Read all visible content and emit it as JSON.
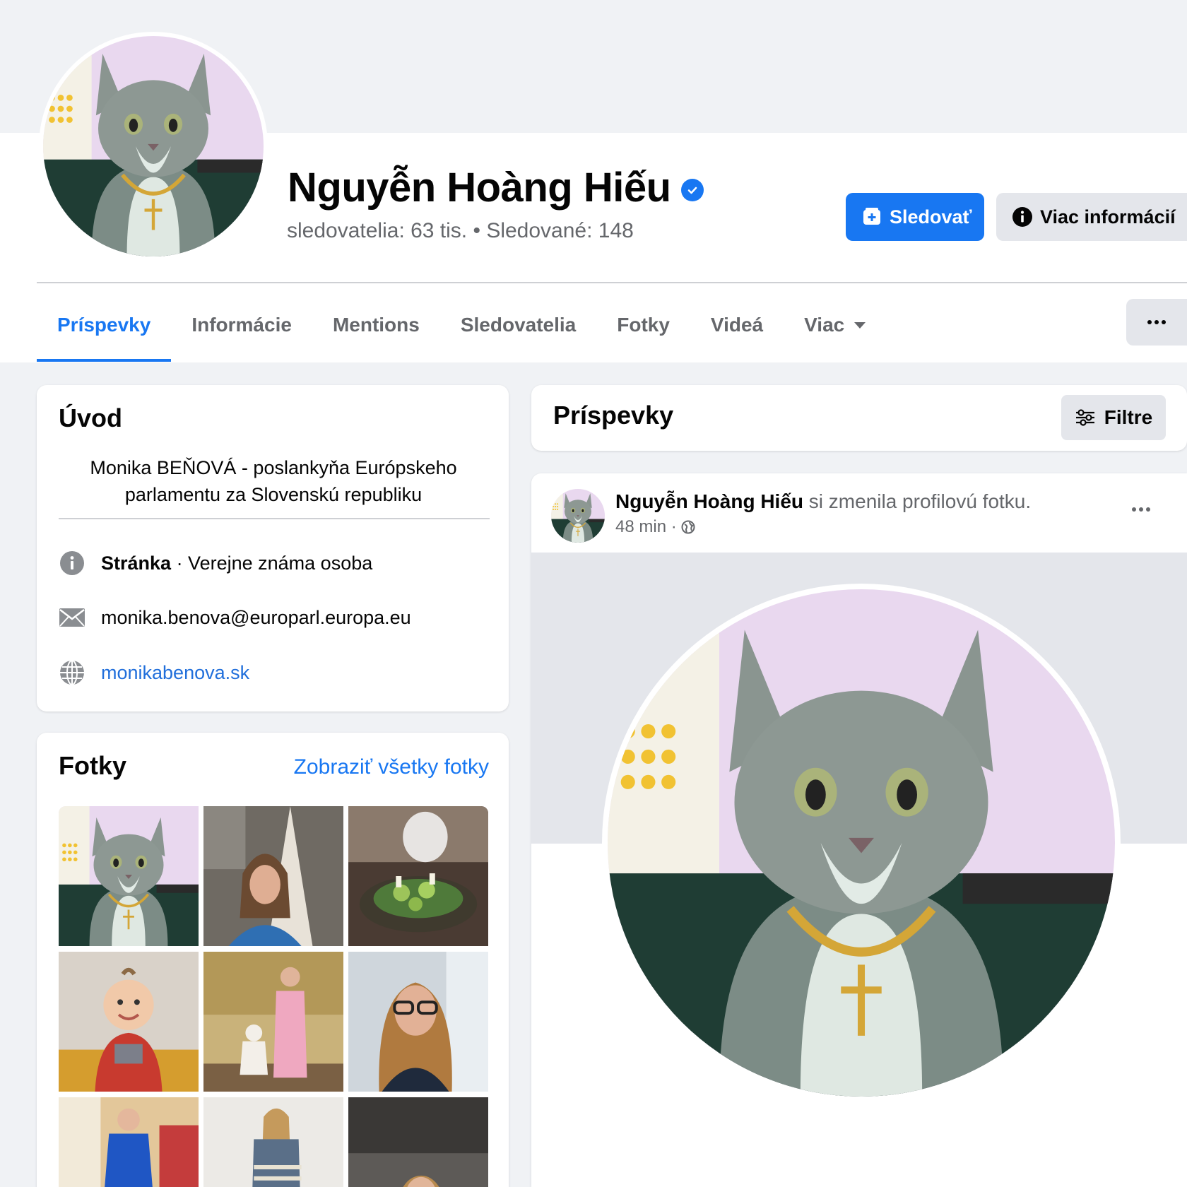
{
  "profile": {
    "name": "Nguyễn Hoàng Hiếu",
    "stats": "sledovatelia: 63 tis. • Sledované: 148",
    "follow_label": "Sledovať",
    "more_info_label": "Viac informácií"
  },
  "tabs": [
    {
      "label": "Príspevky",
      "active": true
    },
    {
      "label": "Informácie"
    },
    {
      "label": "Mentions"
    },
    {
      "label": "Sledovatelia"
    },
    {
      "label": "Fotky"
    },
    {
      "label": "Videá"
    },
    {
      "label": "Viac"
    }
  ],
  "intro": {
    "title": "Úvod",
    "bio": "Monika BEŇOVÁ - poslankyňa Európskeho parlamentu za Slovenskú republiku",
    "category_label": "Stránka",
    "category_value": " · Verejne známa osoba",
    "email": "monika.benova@europarl.europa.eu",
    "website": "monikabenova.sk"
  },
  "photos": {
    "title": "Fotky",
    "see_all": "Zobraziť všetky fotky"
  },
  "posts": {
    "title": "Príspevky",
    "filter_label": "Filtre",
    "post": {
      "author": "Nguyễn Hoàng Hiếu",
      "action": " si zmenila profilovú fotku.",
      "time": "48 min ·"
    }
  },
  "colors": {
    "accent": "#1877f2",
    "link": "#216fdb",
    "page_bg": "#f0f2f5",
    "secondary_text": "#65676b"
  }
}
